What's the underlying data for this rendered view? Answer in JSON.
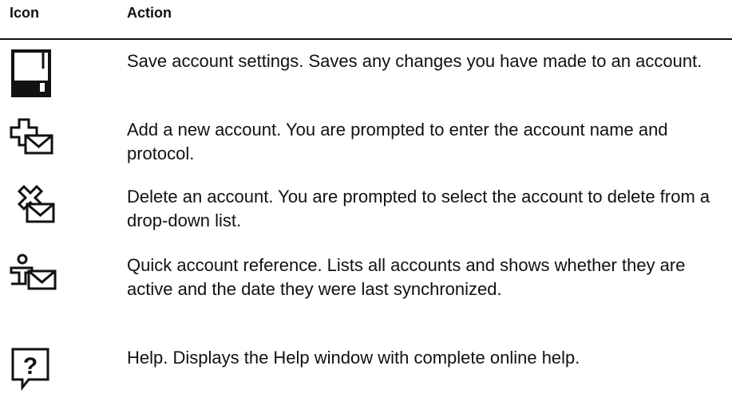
{
  "table": {
    "col_icon": "Icon",
    "col_action": "Action"
  },
  "rows": [
    {
      "icon": "save-icon",
      "text": "Save account settings. Saves any changes you have made to an account."
    },
    {
      "icon": "add-account-icon",
      "text": "Add a new account. You are prompted to enter the account name and protocol."
    },
    {
      "icon": "delete-account-icon",
      "text": "Delete an account. You are prompted to select the account to delete from a drop-down list."
    },
    {
      "icon": "account-reference-icon",
      "text": "Quick account reference. Lists all accounts and shows whether they are active and the date they were last synchronized."
    },
    {
      "icon": "help-icon",
      "text": "Help. Displays the Help window with complete online help."
    }
  ]
}
